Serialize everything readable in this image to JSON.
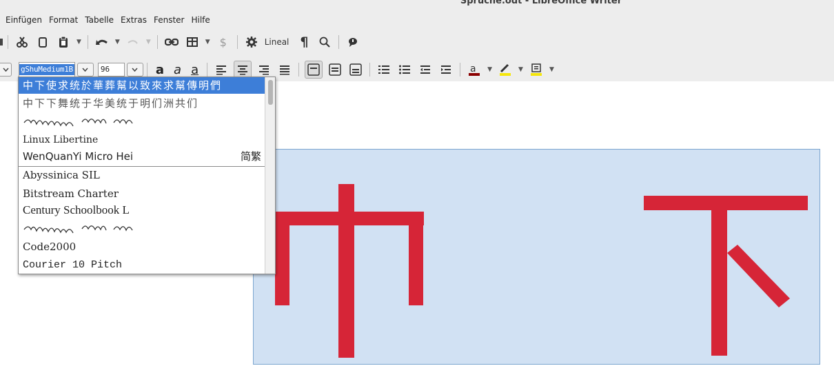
{
  "window": {
    "title": "Sprüche.odt - LibreOffice Writer"
  },
  "menubar": [
    {
      "label": "Einfügen"
    },
    {
      "label": "Format"
    },
    {
      "label": "Tabelle"
    },
    {
      "label": "Extras"
    },
    {
      "label": "Fenster"
    },
    {
      "label": "Hilfe"
    }
  ],
  "toolbar": {
    "lineal_label": "Lineal"
  },
  "formatting": {
    "font_name": "gShuMedium1B",
    "font_size": "96"
  },
  "font_list": {
    "items": [
      {
        "label": "中下使求统於華葬幫以致來求幫傳明們",
        "selected": true
      },
      {
        "label": "中下下舞统于华美统于明们洲共们",
        "selected": false
      },
      {
        "label": "",
        "selected": false
      },
      {
        "label": "Linux Libertine",
        "selected": false
      },
      {
        "label": "WenQuanYi Micro Hei",
        "tag": "简繁",
        "selected": false
      },
      {
        "label": "Abyssinica SIL",
        "selected": false
      },
      {
        "label": "Bitstream Charter",
        "selected": false
      },
      {
        "label": "Century Schoolbook L",
        "selected": false
      },
      {
        "label": "",
        "selected": false
      },
      {
        "label": "Code2000",
        "selected": false
      },
      {
        "label": "Courier 10 Pitch",
        "selected": false
      }
    ]
  },
  "document": {
    "chars": [
      "中",
      "下"
    ],
    "text_color": "#d62537",
    "frame_bg": "#d1e1f3"
  }
}
